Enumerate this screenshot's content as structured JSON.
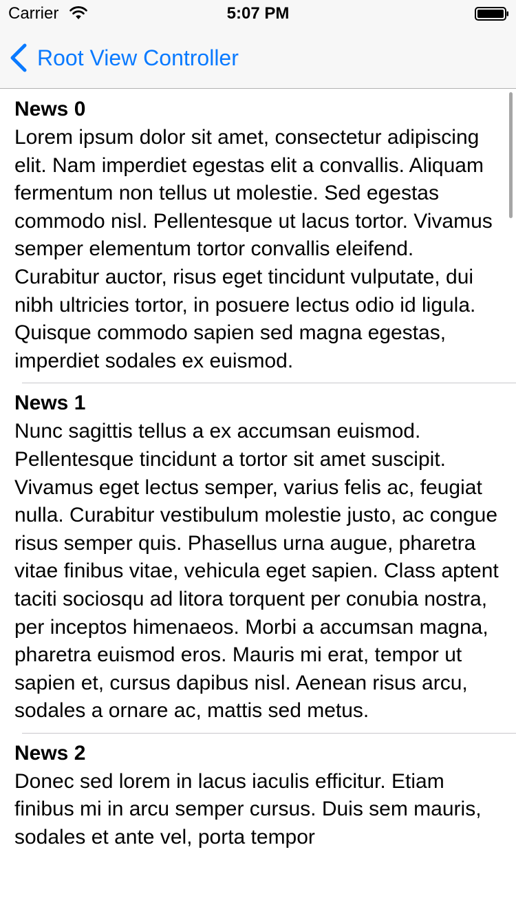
{
  "status_bar": {
    "carrier": "Carrier",
    "time": "5:07 PM",
    "wifi_icon": "wifi-icon",
    "battery_icon": "battery-icon"
  },
  "nav_bar": {
    "back_label": "Root View Controller",
    "back_icon": "chevron-left-icon",
    "tint_color": "#0a7aff"
  },
  "news": [
    {
      "title": "News 0",
      "body": "Lorem ipsum dolor sit amet, consectetur adipiscing elit. Nam imperdiet egestas elit a convallis. Aliquam fermentum non tellus ut molestie. Sed egestas commodo nisl. Pellentesque ut lacus tortor. Vivamus semper elementum tortor convallis eleifend. Curabitur auctor, risus eget tincidunt vulputate, dui nibh ultricies tortor, in posuere lectus odio id ligula. Quisque commodo sapien sed magna egestas, imperdiet sodales ex euismod."
    },
    {
      "title": "News 1",
      "body": "Nunc sagittis tellus a ex accumsan euismod. Pellentesque tincidunt a tortor sit amet suscipit. Vivamus eget lectus semper, varius felis ac, feugiat nulla. Curabitur vestibulum molestie justo, ac congue risus semper quis. Phasellus urna augue, pharetra vitae finibus vitae, vehicula eget sapien. Class aptent taciti sociosqu ad litora torquent per conubia nostra, per inceptos himenaeos. Morbi a accumsan magna, pharetra euismod eros. Mauris mi erat, tempor ut sapien et, cursus dapibus nisl. Aenean risus arcu, sodales a ornare ac, mattis sed metus."
    },
    {
      "title": "News 2",
      "body": "Donec sed lorem in lacus iaculis efficitur. Etiam finibus mi in arcu semper cursus. Duis sem mauris, sodales et ante vel, porta tempor"
    }
  ]
}
